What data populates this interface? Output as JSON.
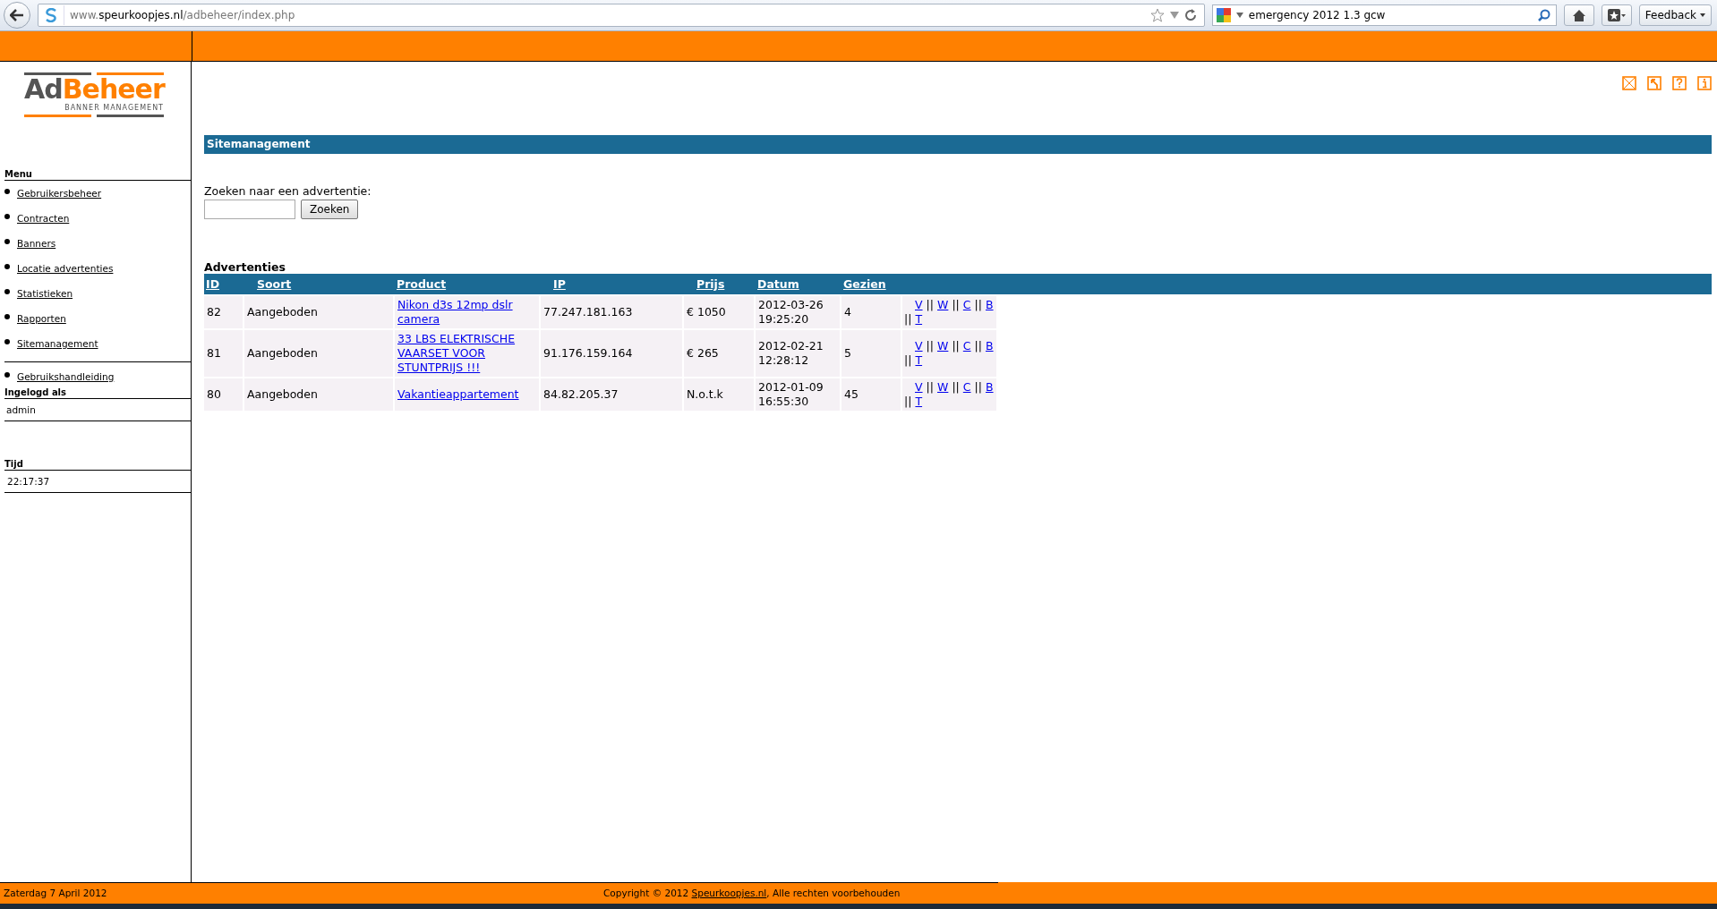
{
  "browser": {
    "url_prefix": "www.",
    "url_domain": "speurkoopjes.nl",
    "url_path": "/adbeheer/index.php",
    "search_value": "emergency 2012 1.3 gcw",
    "feedback": "Feedback"
  },
  "logo": {
    "part1": "Ad",
    "part2": "Beheer",
    "tagline": "BANNER MANAGEMENT"
  },
  "menu": {
    "title": "Menu",
    "items": [
      "Gebruikersbeheer",
      "Contracten",
      "Banners",
      "Locatie advertenties",
      "Statistieken",
      "Rapporten",
      "Sitemanagement"
    ],
    "extra_items": [
      "Gebruikshandleiding"
    ]
  },
  "login": {
    "title": "Ingelogd als",
    "user": "admin"
  },
  "time": {
    "title": "Tijd",
    "value": "22:17:37"
  },
  "page_title": "Sitemanagement",
  "search": {
    "label": "Zoeken naar een advertentie:",
    "button": "Zoeken"
  },
  "table": {
    "title": "Advertenties",
    "columns": [
      "ID",
      "Soort",
      "Product",
      "IP",
      "Prijs",
      "Datum",
      "Gezien"
    ],
    "rows": [
      {
        "id": "82",
        "soort": "Aangeboden",
        "product": "Nikon d3s 12mp dslr camera",
        "ip": "77.247.181.163",
        "prijs": "€ 1050",
        "datum": "2012-03-26 19:25:20",
        "gezien": "4",
        "actions": [
          "V",
          "W",
          "C",
          "B",
          "T"
        ]
      },
      {
        "id": "81",
        "soort": "Aangeboden",
        "product": "33 LBS ELEKTRISCHE VAARSET VOOR STUNTPRIJS !!!",
        "ip": "91.176.159.164",
        "prijs": "€ 265",
        "datum": "2012-02-21 12:28:12",
        "gezien": "5",
        "actions": [
          "V",
          "W",
          "C",
          "B",
          "T"
        ]
      },
      {
        "id": "80",
        "soort": "Aangeboden",
        "product": "Vakantieappartement",
        "ip": "84.82.205.37",
        "prijs": "N.o.t.k",
        "datum": "2012-01-09 16:55:30",
        "gezien": "45",
        "actions": [
          "V",
          "W",
          "C",
          "B",
          "T"
        ]
      }
    ],
    "separator": "||"
  },
  "footer": {
    "date": "Zaterdag 7 April 2012",
    "copyright_before": "Copyright © 2012 ",
    "copyright_link": "Speurkoopjes.nl",
    "copyright_after": ", Alle rechten voorbehouden"
  }
}
